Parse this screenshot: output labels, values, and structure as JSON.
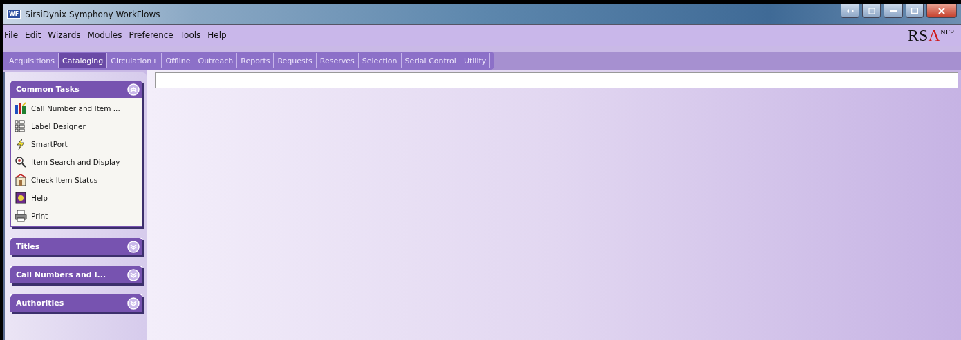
{
  "window": {
    "title": "SirsiDynix Symphony WorkFlows",
    "app_icon": "WF"
  },
  "menu": [
    "File",
    "Edit",
    "Wizards",
    "Modules",
    "Preference",
    "Tools",
    "Help"
  ],
  "logo": {
    "text": "RS",
    "accent": "A",
    "sup": "NFP"
  },
  "tabs": [
    {
      "label": "Acquisitions",
      "selected": false
    },
    {
      "label": "Cataloging",
      "selected": true
    },
    {
      "label": "Circulation+",
      "selected": false
    },
    {
      "label": "Offline",
      "selected": false
    },
    {
      "label": "Outreach",
      "selected": false
    },
    {
      "label": "Reports",
      "selected": false
    },
    {
      "label": "Requests",
      "selected": false
    },
    {
      "label": "Reserves",
      "selected": false
    },
    {
      "label": "Selection",
      "selected": false
    },
    {
      "label": "Serial Control",
      "selected": false
    },
    {
      "label": "Utility",
      "selected": false
    }
  ],
  "sidebar": {
    "groups": [
      {
        "title": "Common Tasks",
        "expanded": true,
        "items": [
          {
            "label": "Call Number and Item ...",
            "kind": "books"
          },
          {
            "label": "Label Designer",
            "kind": "labels"
          },
          {
            "label": "SmartPort",
            "kind": "lightning"
          },
          {
            "label": "Item Search and Display",
            "kind": "search"
          },
          {
            "label": "Check Item Status",
            "kind": "status"
          },
          {
            "label": "Help",
            "kind": "help"
          },
          {
            "label": "Print",
            "kind": "print"
          }
        ]
      },
      {
        "title": "Titles",
        "expanded": false
      },
      {
        "title": "Call Numbers and I...",
        "expanded": false
      },
      {
        "title": "Authorities",
        "expanded": false
      }
    ]
  }
}
